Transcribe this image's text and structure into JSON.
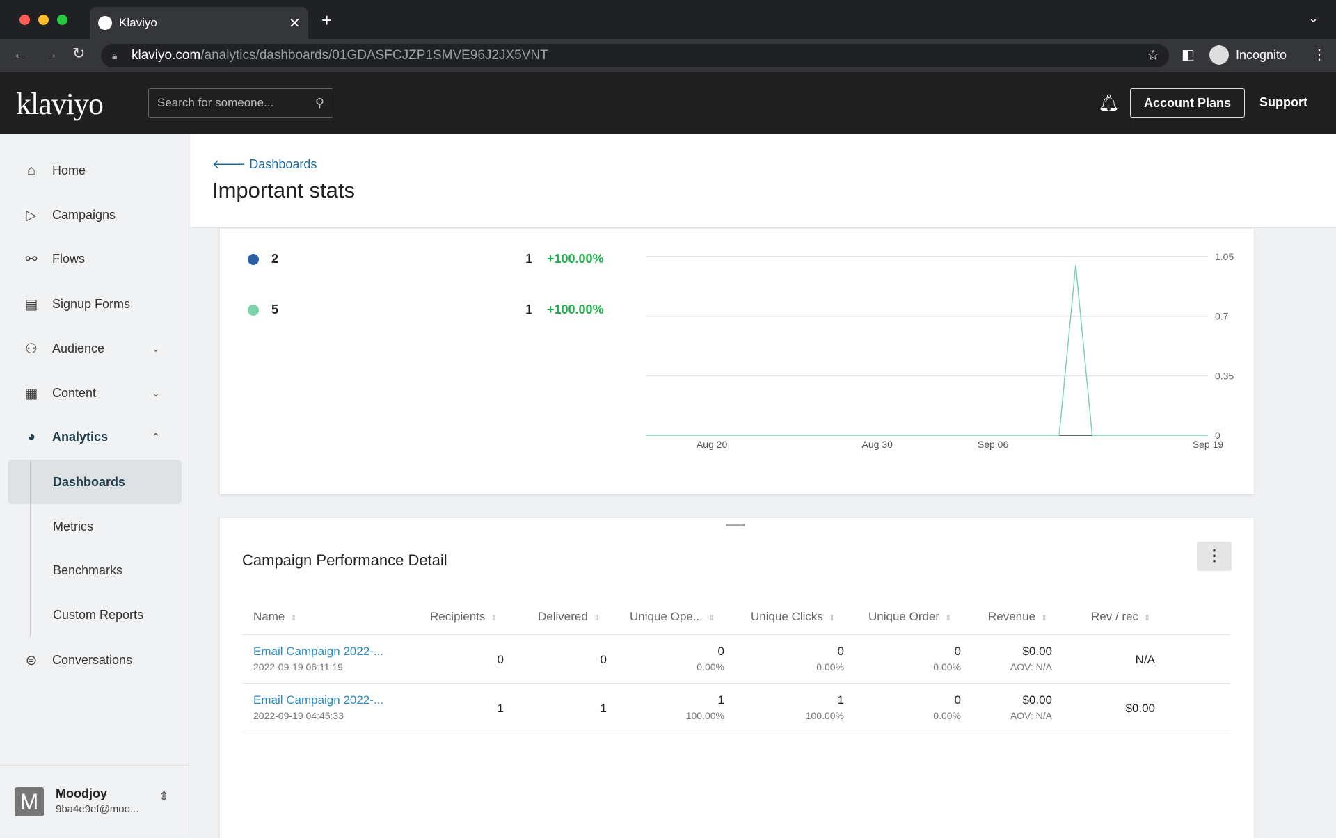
{
  "browser": {
    "tab_title": "Klaviyo",
    "url_domain": "klaviyo.com",
    "url_path": "/analytics/dashboards/01GDASFCJZP1SMVE96J2JX5VNT",
    "incognito_label": "Incognito"
  },
  "header": {
    "logo": "klaviyo",
    "search_placeholder": "Search for someone...",
    "account_plans": "Account Plans",
    "support": "Support"
  },
  "sidebar": {
    "items": [
      {
        "label": "Home",
        "icon": "home-icon"
      },
      {
        "label": "Campaigns",
        "icon": "send-icon"
      },
      {
        "label": "Flows",
        "icon": "flows-icon"
      },
      {
        "label": "Signup Forms",
        "icon": "form-icon"
      },
      {
        "label": "Audience",
        "icon": "audience-icon"
      },
      {
        "label": "Content",
        "icon": "content-icon"
      },
      {
        "label": "Analytics",
        "icon": "pie-chart-icon"
      }
    ],
    "analytics_sub": [
      "Dashboards",
      "Metrics",
      "Benchmarks",
      "Custom Reports"
    ],
    "conversations": "Conversations",
    "user": {
      "initial": "M",
      "name": "Moodjoy",
      "email": "9ba4e9ef@moo..."
    }
  },
  "page": {
    "breadcrumb": "Dashboards",
    "title": "Important stats"
  },
  "chart_data": {
    "type": "line",
    "legend": [
      {
        "name": "2",
        "value": "1",
        "change": "+100.00%",
        "color": "#2a5fa8"
      },
      {
        "name": "5",
        "value": "1",
        "change": "+100.00%",
        "color": "#7fd3ac"
      }
    ],
    "x_ticks": [
      "Aug 20",
      "Aug 30",
      "Sep 06",
      "Sep 19"
    ],
    "y_ticks": [
      "0",
      "0.35",
      "0.7",
      "1.05"
    ],
    "ylim": [
      0,
      1.05
    ],
    "x": [
      "2022-09-10",
      "2022-09-11",
      "2022-09-12"
    ],
    "series": [
      {
        "name": "5",
        "color": "#7fd3ac",
        "values": [
          0,
          1,
          0
        ]
      },
      {
        "name": "2",
        "color": "#444444",
        "values": [
          0,
          0,
          0
        ]
      }
    ]
  },
  "table": {
    "title": "Campaign Performance Detail",
    "columns": [
      "Name",
      "Recipients",
      "Delivered",
      "Unique Ope...",
      "Unique Clicks",
      "Unique Order",
      "Revenue",
      "Rev / rec"
    ],
    "rows": [
      {
        "name": "Email Campaign 2022-...",
        "date": "2022-09-19 06:11:19",
        "recipients": "0",
        "delivered": "0",
        "opens": "0",
        "opens_pct": "0.00%",
        "clicks": "0",
        "clicks_pct": "0.00%",
        "orders": "0",
        "orders_pct": "0.00%",
        "revenue": "$0.00",
        "aov": "AOV: N/A",
        "rev_rec": "N/A"
      },
      {
        "name": "Email Campaign 2022-...",
        "date": "2022-09-19 04:45:33",
        "recipients": "1",
        "delivered": "1",
        "opens": "1",
        "opens_pct": "100.00%",
        "clicks": "1",
        "clicks_pct": "100.00%",
        "orders": "0",
        "orders_pct": "0.00%",
        "revenue": "$0.00",
        "aov": "AOV: N/A",
        "rev_rec": "$0.00"
      }
    ]
  }
}
